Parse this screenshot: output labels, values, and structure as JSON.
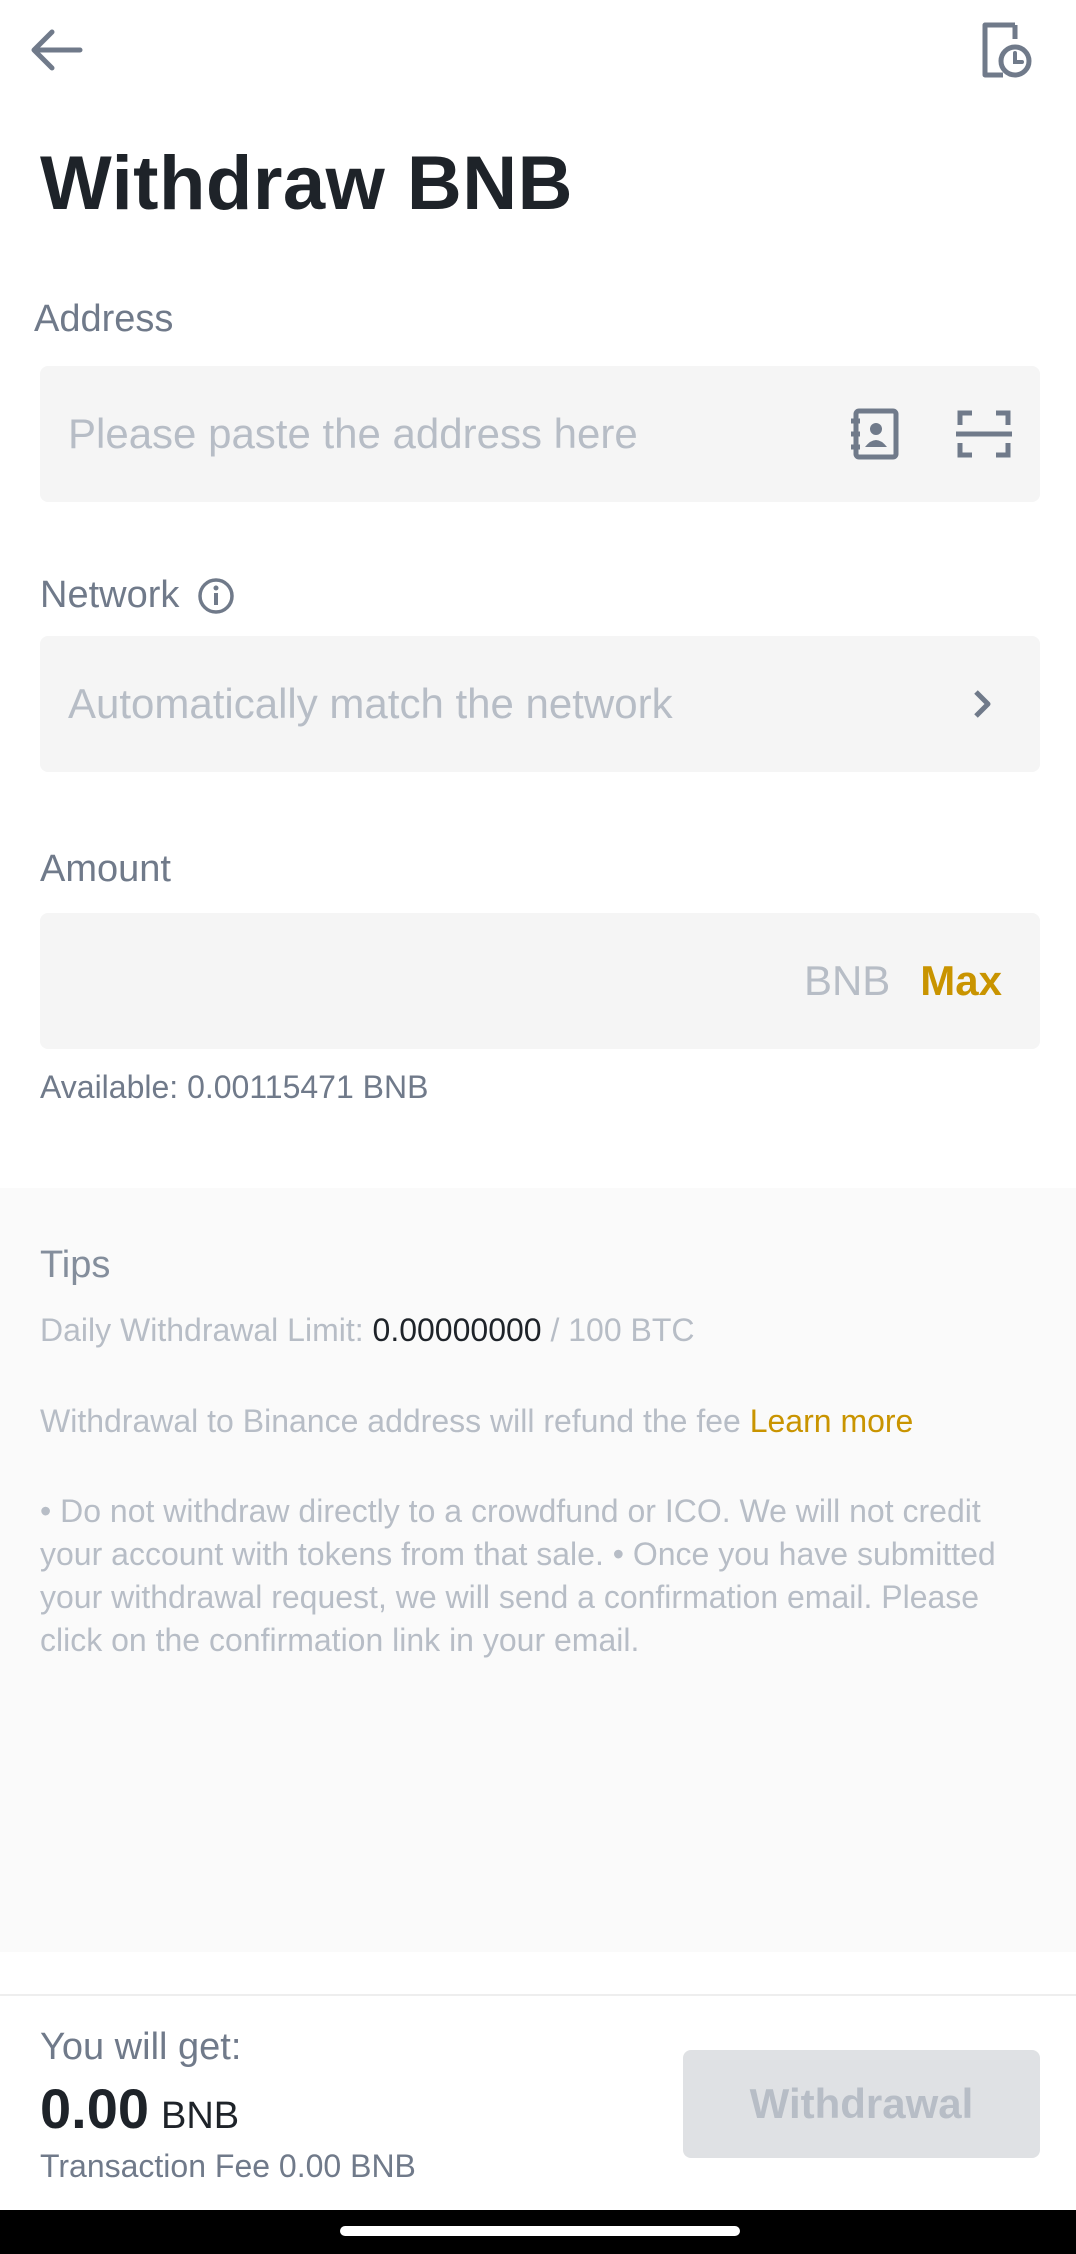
{
  "header": {
    "back_icon": "arrow-left-icon",
    "history_icon": "history-document-icon",
    "title": "Withdraw BNB"
  },
  "address": {
    "label": "Address",
    "placeholder": "Please paste the address here",
    "address_book_icon": "address-book-icon",
    "scan_icon": "scan-icon"
  },
  "network": {
    "label": "Network",
    "info_icon": "info-icon",
    "placeholder": "Automatically match the network",
    "chevron_icon": "chevron-right-icon"
  },
  "amount": {
    "label": "Amount",
    "unit": "BNB",
    "max_label": "Max",
    "available": "Available: 0.00115471 BNB"
  },
  "tips": {
    "title": "Tips",
    "limit_prefix": "Daily Withdrawal Limit: ",
    "limit_used": "0.00000000",
    "limit_suffix": " / 100 BTC",
    "refund_text": "Withdrawal to Binance address will refund the fee ",
    "learn_more": "Learn more",
    "notes": "• Do not withdraw directly to a crowdfund or ICO. We will not credit your account with tokens from that sale. • Once you have submitted your withdrawal request, we will send a confirmation email. Please click on the confirmation link in your email."
  },
  "footer": {
    "you_get_label": "You will get:",
    "you_get_amount": "0.00",
    "you_get_unit": "BNB",
    "fee_label": "Transaction Fee",
    "fee_value": "0.00 BNB",
    "withdraw_label": "Withdrawal"
  },
  "colors": {
    "accent": "#c99400",
    "field_bg": "#f5f5f5",
    "disabled_button": "#dfe1e4"
  }
}
